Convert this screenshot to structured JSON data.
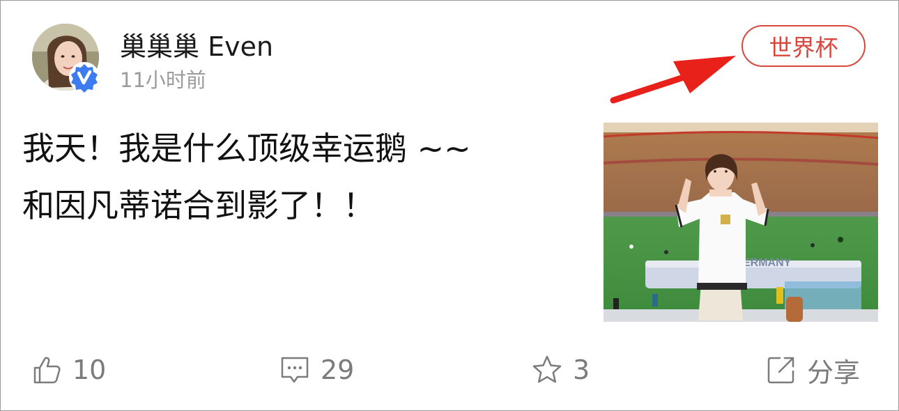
{
  "post": {
    "author": "巢巢巢 Even",
    "time": "11小时前",
    "topic_tag": "世界杯",
    "text": "我天！我是什么顶级幸运鹅 ~~\n和因凡蒂诺合到影了！！",
    "photo_banner_text": "ERMANY"
  },
  "actions": {
    "like_count": "10",
    "comment_count": "29",
    "favorite_count": "3",
    "share_label": "分享"
  },
  "colors": {
    "tag_red": "#d6483e",
    "arrow_red": "#e8221b",
    "verified_blue": "#3c7bf0",
    "muted_gray": "#9b9b9b"
  },
  "icons": {
    "like": "thumbs-up-icon",
    "comment": "comment-icon",
    "favorite": "star-icon",
    "share": "share-icon",
    "verified": "verified-badge-icon"
  }
}
